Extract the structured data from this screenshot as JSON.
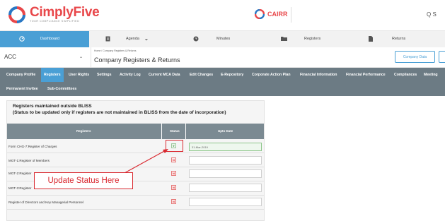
{
  "brand": {
    "name": "CimplyFive",
    "tagline": "YOUR COMPLIANCE SIMPLIFIED",
    "secondary_logo": "CAIRR",
    "color": "#e8474a"
  },
  "header": {
    "search_stub": "Q S"
  },
  "modules": [
    {
      "label": "Dashboard",
      "icon": "dashboard-icon",
      "active": true
    },
    {
      "label": "Agenda",
      "icon": "agenda-icon"
    },
    {
      "label": "Minutes",
      "icon": "clock-icon"
    },
    {
      "label": "Registers",
      "icon": "folder-icon"
    },
    {
      "label": "Returns",
      "icon": "document-icon"
    }
  ],
  "company": {
    "selected": "ACC",
    "breadcrumb": "Home / Company Registers & Returns",
    "title": "Company Registers & Returns",
    "company_data_button": "Company Data"
  },
  "subtabs_row1": [
    "Company Profile",
    "Registers",
    "User Rights",
    "Settings",
    "Activity Log",
    "Current MCA Data",
    "Edit Changes",
    "E-Repository",
    "Corporate Action Plan",
    "Financial Information",
    "Financial Performance",
    "Compliances",
    "Meeting"
  ],
  "subtabs_row2": [
    "Permanent Invitee",
    "Sub-Committees"
  ],
  "active_subtab": "Registers",
  "panel": {
    "title": "Registers maintained outside BLISS",
    "subtitle": "(Status to be updated only if registers are not maintained in BLISS from the date of incorporation)",
    "columns": [
      "Registers",
      "Status",
      "Upto Date"
    ],
    "rows": [
      {
        "name": "Form CHG-7:Register of Charges",
        "status": "Y",
        "date": "31-Mar-2019"
      },
      {
        "name": "MGT-1:Register of Members",
        "status": "N",
        "date": ""
      },
      {
        "name": "MGT-2:Register",
        "status": "N",
        "date": ""
      },
      {
        "name": "MGT-3:Register",
        "status": "N",
        "date": ""
      },
      {
        "name": "Register of Directors and Key Managerial Personnel",
        "status": "N",
        "date": ""
      }
    ]
  },
  "annotation": {
    "callout_text": "Update Status Here",
    "color": "#d9282f"
  },
  "colors": {
    "accent": "#4a9fd5",
    "tab_bar": "#6c7b84",
    "table_header": "#7b8a92"
  }
}
